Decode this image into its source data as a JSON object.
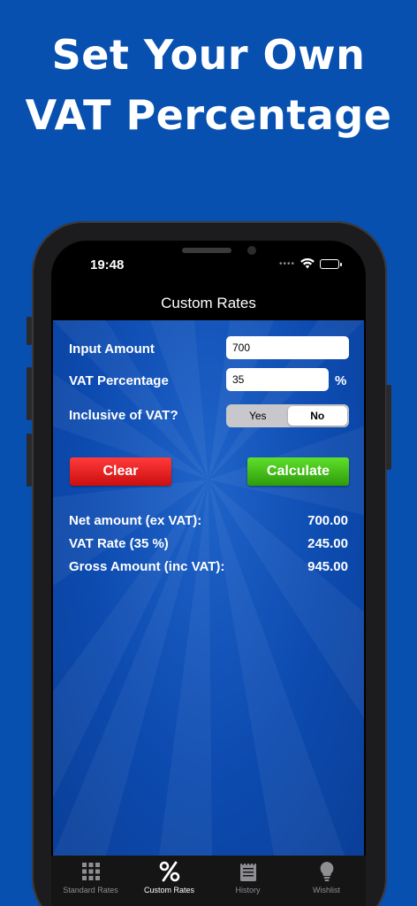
{
  "promo": {
    "line1": "Set Your Own",
    "line2": "VAT Percentage"
  },
  "status": {
    "time": "19:48"
  },
  "navbar": {
    "title": "Custom Rates"
  },
  "form": {
    "input_amount_label": "Input Amount",
    "input_amount_value": "700",
    "vat_percentage_label": "VAT Percentage",
    "vat_percentage_value": "35",
    "percent_sign": "%",
    "inclusive_label": "Inclusive of VAT?",
    "segment_yes": "Yes",
    "segment_no": "No",
    "selected_segment": "No"
  },
  "buttons": {
    "clear": "Clear",
    "calculate": "Calculate"
  },
  "results": {
    "net_label": "Net amount (ex VAT):",
    "net_value": "700.00",
    "vat_label": "VAT Rate (35 %)",
    "vat_value": "245.00",
    "gross_label": "Gross Amount (inc VAT):",
    "gross_value": "945.00"
  },
  "tabbar": {
    "items": [
      {
        "label": "Standard Rates",
        "icon": "grid-icon"
      },
      {
        "label": "Custom Rates",
        "icon": "percent-icon"
      },
      {
        "label": "History",
        "icon": "notepad-icon"
      },
      {
        "label": "Wishlist",
        "icon": "lightbulb-icon"
      }
    ],
    "active": "Custom Rates"
  },
  "colors": {
    "background": "#0750b0",
    "clear_button": "#e01e1e",
    "calculate_button": "#48c21b"
  }
}
